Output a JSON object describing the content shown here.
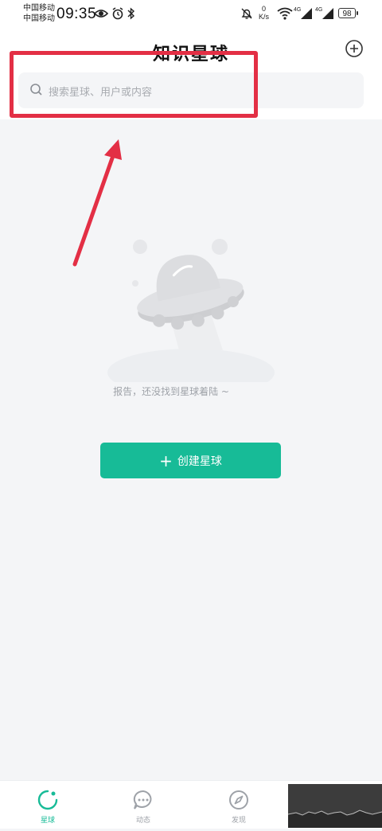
{
  "status_bar": {
    "carrier1": "中国移动",
    "carrier2": "中国移动",
    "time": "09:35",
    "net_speed_value": "0",
    "net_speed_unit": "K/s",
    "signal1_label": "4G",
    "signal2_label": "4G",
    "battery": "98"
  },
  "header": {
    "title": "知识星球",
    "search_placeholder": "搜索星球、用户或内容"
  },
  "empty_state": {
    "message": "报告，还没找到星球着陆 ~"
  },
  "create_button": {
    "plus": "+",
    "label": "创建星球"
  },
  "tabs": [
    {
      "label": "星球",
      "icon": "planet-icon",
      "active": true
    },
    {
      "label": "动态",
      "icon": "chat-bubble-icon",
      "active": false
    },
    {
      "label": "发现",
      "icon": "compass-icon",
      "active": false
    }
  ],
  "colors": {
    "accent": "#17bb97",
    "annotation": "#e32f45",
    "background": "#f4f5f7"
  }
}
